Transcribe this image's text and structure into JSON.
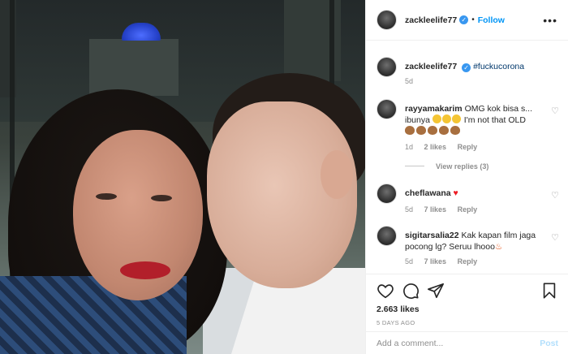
{
  "post": {
    "username": "zackleelife77",
    "follow_label": "Follow",
    "more_label": "•••",
    "caption": {
      "username": "zackleelife77",
      "hashtag": "#fuckucorona",
      "time": "5d"
    }
  },
  "comments": [
    {
      "username": "rayyamakarim",
      "text": "OMG kok bisa s... ibunya",
      "text_after": "I'm not that OLD",
      "time": "1d",
      "likes": "2 likes",
      "reply_label": "Reply",
      "view_replies": "View replies (3)"
    },
    {
      "username": "cheflawana",
      "text": "",
      "time": "5d",
      "likes": "7 likes",
      "reply_label": "Reply"
    },
    {
      "username": "sigitarsalia22",
      "text": "Kak kapan film jaga pocong lg? Seruu lhooo",
      "time": "5d",
      "likes": "7 likes",
      "reply_label": "Reply"
    }
  ],
  "stats": {
    "likes": "2.663 likes",
    "posted": "5 DAYS AGO"
  },
  "composer": {
    "placeholder": "Add a comment...",
    "post_label": "Post"
  },
  "colors": {
    "link_blue": "#0095f6",
    "verified": "#3897f0",
    "muted": "#8e8e8e"
  }
}
